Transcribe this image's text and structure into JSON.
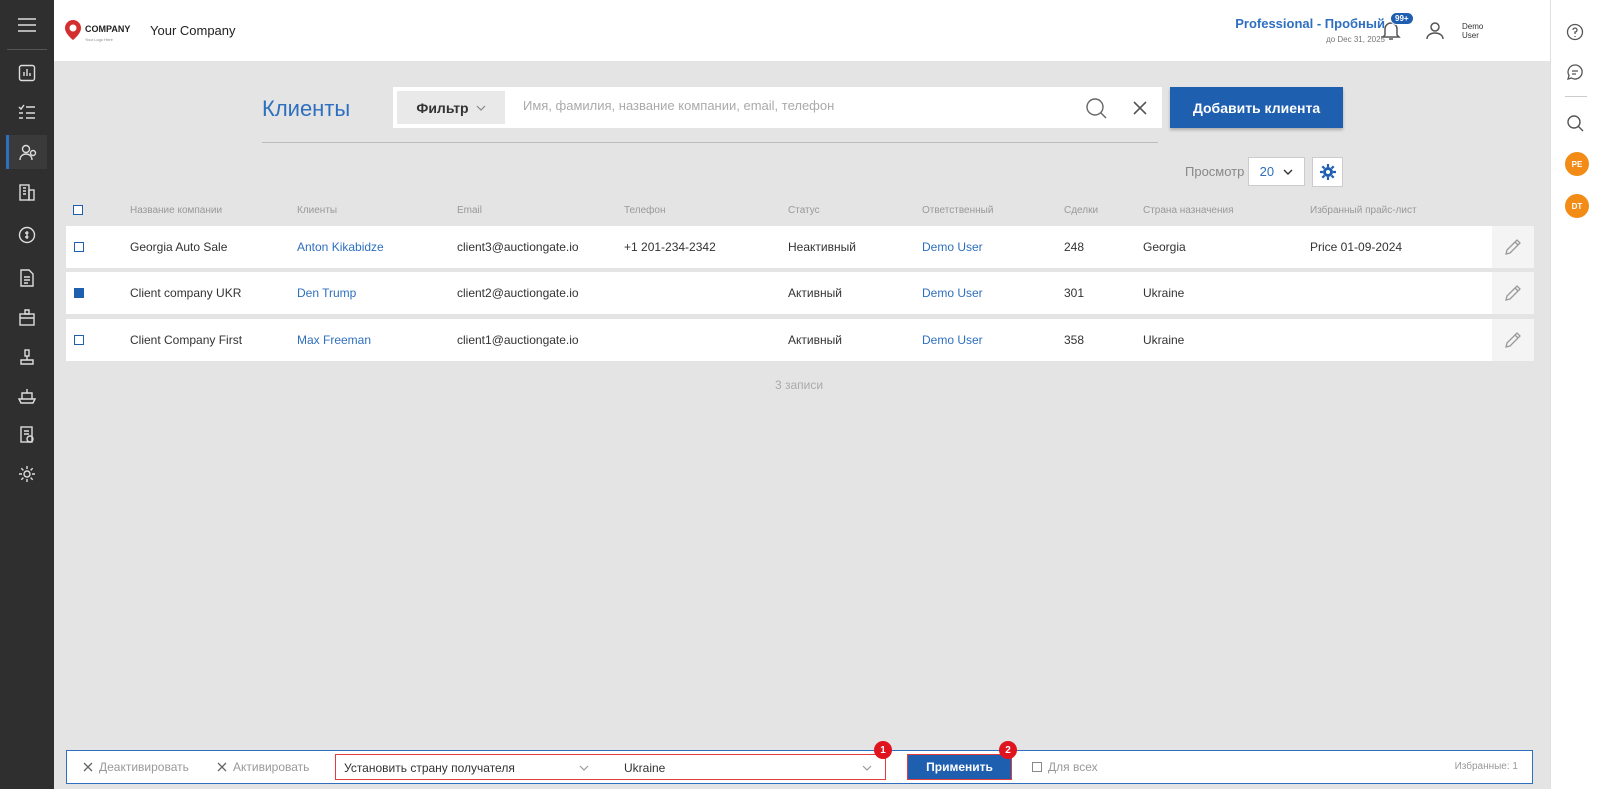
{
  "header": {
    "logo": {
      "text": "COMPANY",
      "sub": "Your Logo Here"
    },
    "company_name": "Your Company",
    "plan_title": "Professional - Пробный",
    "plan_until": "до Dec 31, 2025",
    "notifications_badge": "99+",
    "user_line1": "Demo",
    "user_line2": "User"
  },
  "right_avatars": [
    "PE",
    "DT"
  ],
  "page": {
    "title": "Клиенты",
    "filter_label": "Фильтр",
    "search_placeholder": "Имя, фамилия, название компании, email, телефон",
    "add_button": "Добавить клиента",
    "view_label": "Просмотр",
    "view_value": "20"
  },
  "table": {
    "headers": [
      "Название компании",
      "Клиенты",
      "Email",
      "Телефон",
      "Статус",
      "Ответственный",
      "Сделки",
      "Страна назначения",
      "Избранный прайс-лист"
    ],
    "rows": [
      {
        "company": "Georgia Auto Sale",
        "client": "Anton Kikabidze",
        "email": "client3@auctiongate.io",
        "phone": "+1 201-234-2342",
        "status": "Неактивный",
        "manager": "Demo User",
        "deals": "248",
        "country": "Georgia",
        "price_list": "Price 01-09-2024",
        "checked": false
      },
      {
        "company": "Client company UKR",
        "client": "Den Trump",
        "email": "client2@auctiongate.io",
        "phone": "",
        "status": "Активный",
        "manager": "Demo User",
        "deals": "301",
        "country": "Ukraine",
        "price_list": "",
        "checked": true
      },
      {
        "company": "Client Company First",
        "client": "Max Freeman",
        "email": "client1@auctiongate.io",
        "phone": "",
        "status": "Активный",
        "manager": "Demo User",
        "deals": "358",
        "country": "Ukraine",
        "price_list": "",
        "checked": false
      }
    ],
    "records_count": "3 записи"
  },
  "bulk_bar": {
    "deactivate": "Деактивировать",
    "activate": "Активировать",
    "action_select": "Установить страну получателя",
    "country_select": "Ukraine",
    "apply": "Применить",
    "marker1": "1",
    "marker2": "2",
    "for_all": "Для всех",
    "selected": "Избранные: 1"
  },
  "colors": {
    "accent": "#1f5fb0",
    "sidebar": "#2f2f2f",
    "marker": "#e0141e",
    "avatar": "#f28c16"
  }
}
